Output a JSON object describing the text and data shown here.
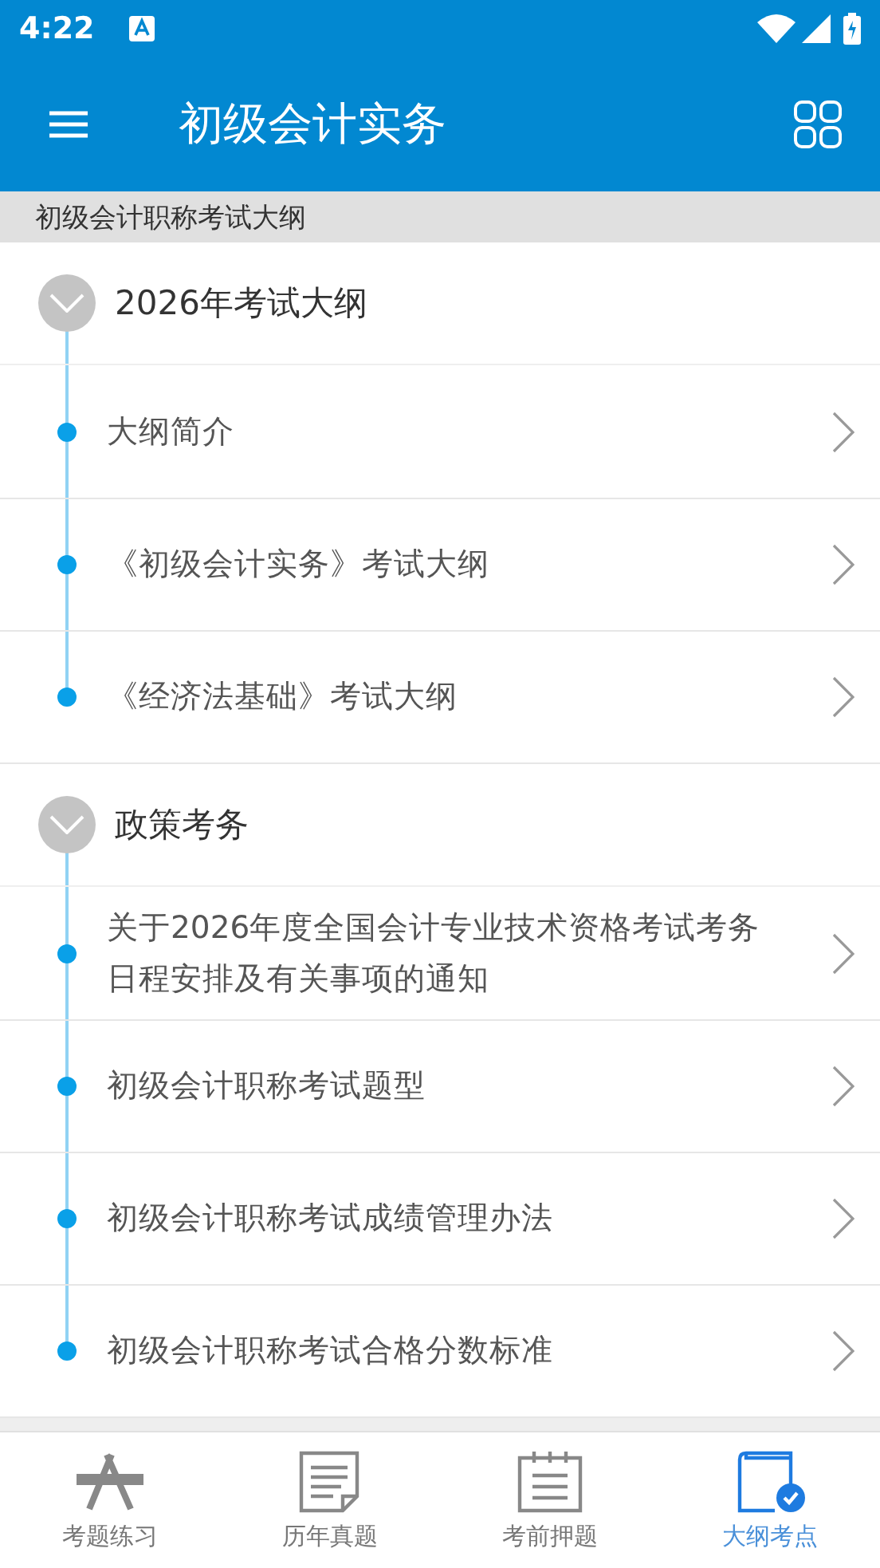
{
  "status_bar": {
    "time": "4:22"
  },
  "toolbar": {
    "title": "初级会计实务"
  },
  "subheader": "初级会计职称考试大纲",
  "sections": [
    {
      "title": "2026年考试大纲",
      "expanded": true,
      "items": [
        {
          "label": "大纲简介"
        },
        {
          "label": "《初级会计实务》考试大纲"
        },
        {
          "label": "《经济法基础》考试大纲"
        }
      ]
    },
    {
      "title": "政策考务",
      "expanded": true,
      "items": [
        {
          "label": "关于2026年度全国会计专业技术资格考试考务日程安排及有关事项的通知"
        },
        {
          "label": "初级会计职称考试题型"
        },
        {
          "label": "初级会计职称考试成绩管理办法"
        },
        {
          "label": "初级会计职称考试合格分数标准"
        }
      ]
    }
  ],
  "bottom_nav": [
    {
      "label": "考题练习",
      "kind": "practice",
      "selected": false
    },
    {
      "label": "历年真题",
      "kind": "papers",
      "selected": false
    },
    {
      "label": "考前押题",
      "kind": "notepad",
      "selected": false
    },
    {
      "label": "大纲考点",
      "kind": "book",
      "selected": true
    }
  ]
}
